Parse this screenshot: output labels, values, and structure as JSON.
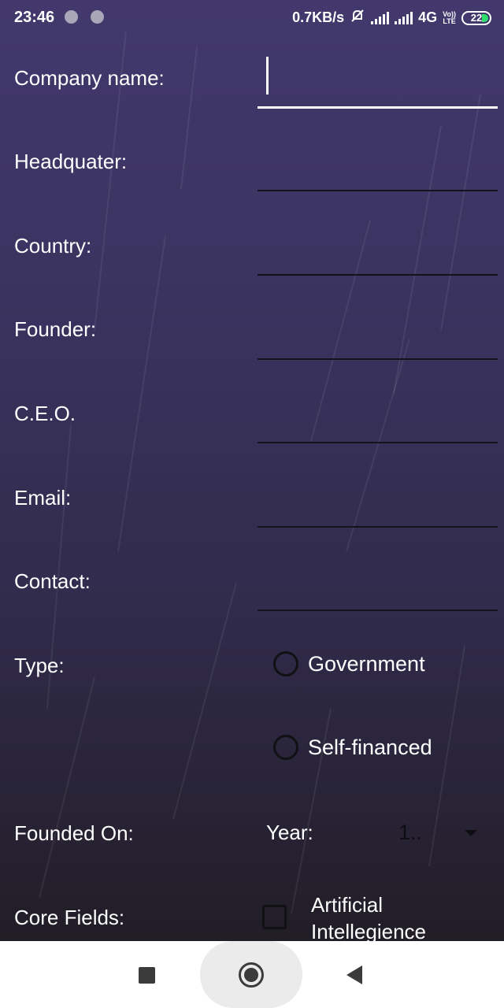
{
  "status_bar": {
    "time": "23:46",
    "network_speed": "0.7KB/s",
    "network_type": "4G",
    "volte_top": "Vo))",
    "volte_bottom": "LTE",
    "battery": "22"
  },
  "form": {
    "company_name_label": "Company name:",
    "headquater_label": "Headquater:",
    "country_label": "Country:",
    "founder_label": "Founder:",
    "ceo_label": "C.E.O.",
    "email_label": "Email:",
    "contact_label": "Contact:",
    "type_label": "Type:",
    "type_options": [
      "Government",
      "Self-financed"
    ],
    "founded_on_label": "Founded On:",
    "year_label": "Year:",
    "year_value": "1..",
    "core_fields_label": "Core Fields:",
    "core_field_option_line1": "Artificial",
    "core_field_option_line2": "Intellegience"
  },
  "colors": {
    "background_top": "#42386d",
    "background_bottom": "#1f1c24",
    "text": "#ffffff",
    "battery_charge": "#2ee06b"
  },
  "icons": {
    "nav_recent": "square-icon",
    "nav_home": "circle-icon",
    "nav_back": "triangle-back-icon",
    "status_silent": "bell-off-icon"
  }
}
